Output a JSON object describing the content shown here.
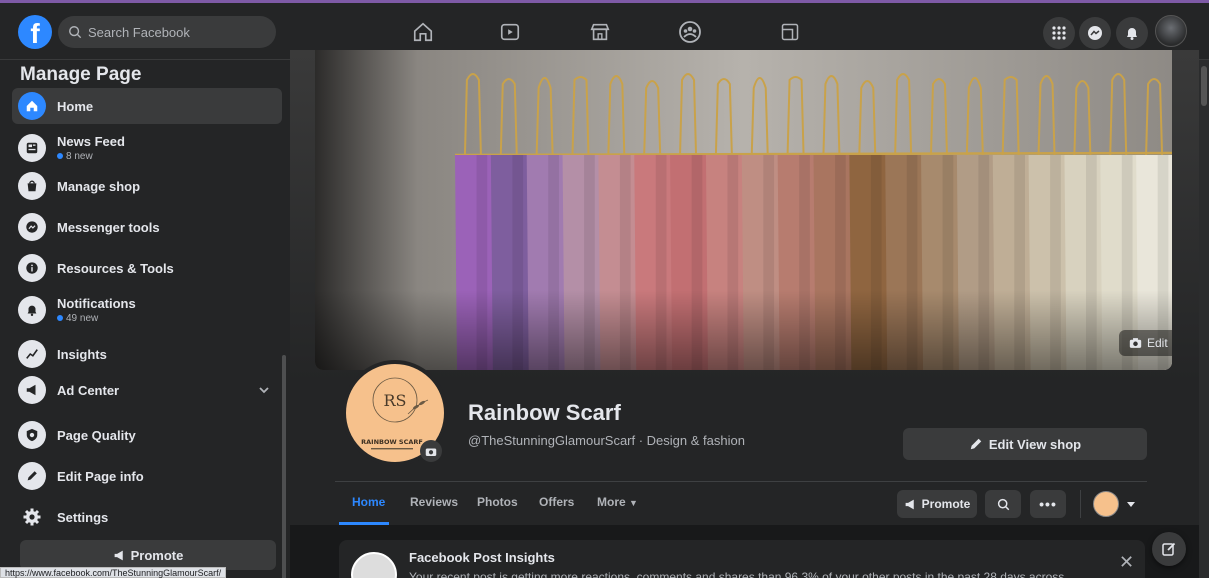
{
  "topbar": {
    "logo_letter": "f",
    "search_placeholder": "Search Facebook",
    "nav": [
      "home-icon",
      "watch-icon",
      "marketplace-icon",
      "groups-icon",
      "gaming-icon"
    ],
    "right": [
      "menu-grid-icon",
      "messenger-icon",
      "notifications-icon",
      "account-avatar"
    ]
  },
  "sidebar": {
    "title": "Manage Page",
    "items": [
      {
        "label": "Home",
        "icon": "home-icon",
        "active": true
      },
      {
        "label": "News Feed",
        "sub": "8 new",
        "icon": "news-feed-icon"
      },
      {
        "label": "Manage shop",
        "icon": "shop-bag-icon"
      },
      {
        "label": "Messenger tools",
        "icon": "messenger-icon"
      },
      {
        "label": "Resources & Tools",
        "icon": "info-icon"
      },
      {
        "label": "Notifications",
        "sub": "49 new",
        "icon": "bell-icon"
      },
      {
        "label": "Insights",
        "icon": "insights-icon"
      },
      {
        "label": "Ad Center",
        "icon": "megaphone-icon",
        "expandable": true
      },
      {
        "label": "Page Quality",
        "icon": "shield-icon"
      },
      {
        "label": "Edit Page info",
        "icon": "pencil-icon"
      },
      {
        "label": "Settings",
        "icon": "gear-icon"
      }
    ],
    "promote_label": "Promote"
  },
  "status_url": "https://www.facebook.com/TheStunningGlamourScarf/",
  "page": {
    "cover_edit_label": "Edit",
    "logo_brand": "RAINBOW SCARF",
    "logo_monogram": "RS",
    "name": "Rainbow Scarf",
    "handle": "@TheStunningGlamourScarf · Design & fashion",
    "edit_shop_label": "Edit View shop",
    "tabs": [
      "Home",
      "Reviews",
      "Photos",
      "Offers",
      "More"
    ],
    "promote_label": "Promote"
  },
  "insight": {
    "title": "Facebook Post Insights",
    "body": "Your recent post is getting more reactions, comments and shares than 96.3% of your other posts in the past 28 days across"
  },
  "colors": {
    "accent": "#2d88ff",
    "background": "#18191a",
    "surface": "#242526",
    "scarves": [
      "#9b62b8",
      "#7e5e9e",
      "#a17bb0",
      "#b48fa7",
      "#c48d92",
      "#c9797c",
      "#c26f72",
      "#c7827f",
      "#bf8e83",
      "#b77c6f",
      "#a97560",
      "#8f6540",
      "#9b7657",
      "#a78a6d",
      "#b19c86",
      "#bfae96",
      "#ccc1ab",
      "#d8d2bf",
      "#e0dccb",
      "#e9e6da"
    ]
  }
}
